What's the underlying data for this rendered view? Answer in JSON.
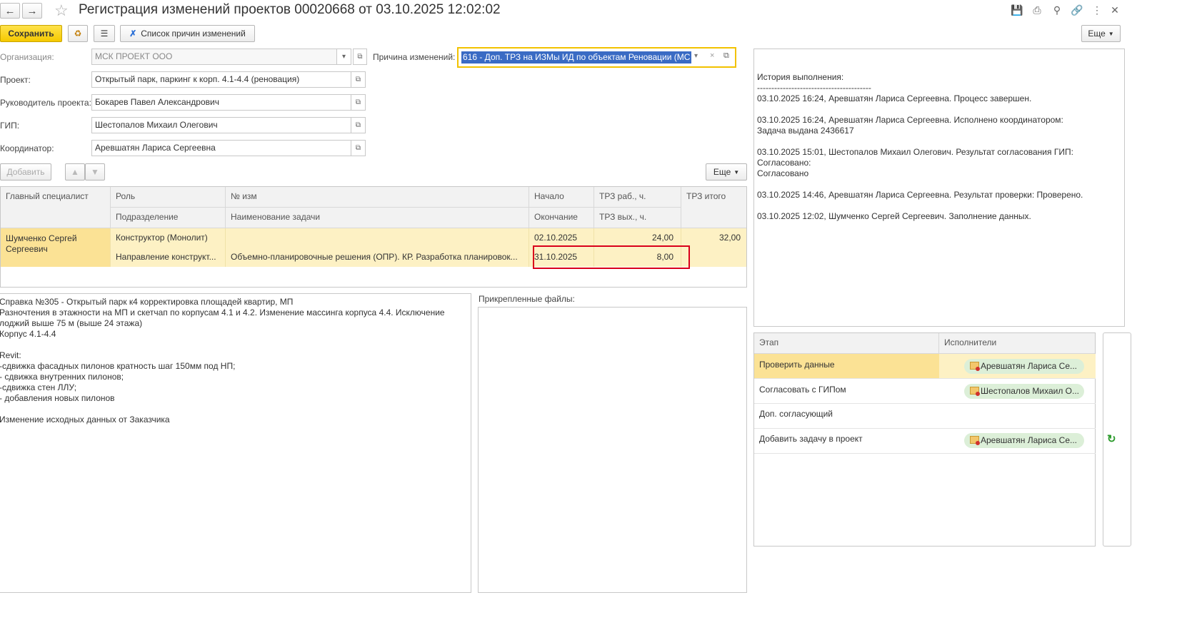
{
  "window": {
    "title": "Регистрация изменений проектов 00020668 от 03.10.2025 12:02:02"
  },
  "toolbar": {
    "save_label": "Сохранить",
    "reasons_list_label": "Список причин изменений",
    "more_label": "Еще"
  },
  "form": {
    "organization": {
      "label": "Организация:",
      "value": "МСК ПРОЕКТ ООО"
    },
    "project": {
      "label": "Проект:",
      "value": "Открытый парк, паркинг к корп. 4.1-4.4 (реновация)"
    },
    "project_manager": {
      "label": "Руководитель проекта:",
      "value": "Бокарев Павел Александрович"
    },
    "gip": {
      "label": "ГИП:",
      "value": "Шестопалов Михаил Олегович"
    },
    "coordinator": {
      "label": "Координатор:",
      "value": "Аревшатян Лариса Сергеевна"
    },
    "reason": {
      "label": "Причина изменений:",
      "value": "616 - Доп. ТРЗ на ИЗМы ИД по объектам Реновации (МС"
    }
  },
  "table_toolbar": {
    "add_label": "Добавить",
    "more_label": "Еще"
  },
  "table": {
    "headers": {
      "main_specialist": "Главный специалист",
      "role": "Роль",
      "department": "Подразделение",
      "change_no": "№ изм",
      "task_name": "Наименование задачи",
      "start": "Начало",
      "end": "Окончание",
      "trz_work": "ТРЗ раб., ч.",
      "trz_weekend": "ТРЗ вых., ч.",
      "trz_total": "ТРЗ итого"
    },
    "rows": [
      {
        "main_specialist": "Шумченко Сергей Сергеевич",
        "role": "Конструктор (Монолит)",
        "department": "Направление конструкт...",
        "change_no": "",
        "task_name": "Объемно-планировочные решения (ОПР). КР. Разработка планировок...",
        "start": "02.10.2025",
        "end": "31.10.2025",
        "trz_work": "24,00",
        "trz_weekend": "8,00",
        "trz_total": "32,00"
      }
    ]
  },
  "description": "Справка №305 - Открытый парк к4 корректировка площадей квартир, МП\nРазночтения в этажности на МП и скетчап по корпусам 4.1 и 4.2. Изменение массинга корпуса 4.4. Исключение лоджий выше 75 м (выше 24 этажа)\nКорпус 4.1-4.4\n\nRevit:\n-сдвижка фасадных пилонов  кратность шаг 150мм под НП;\n- сдвижка внутренних пилонов;\n-сдвижка стен ЛЛУ;\n- добавления новых пилонов\n\nИзменение исходных данных от Заказчика",
  "attachments": {
    "label": "Прикрепленные файлы:"
  },
  "history": {
    "text": "История выполнения:\n----------------------------------------\n03.10.2025 16:24, Аревшатян Лариса Сергеевна. Процесс завершен.\n\n03.10.2025 16:24, Аревшатян Лариса Сергеевна. Исполнено координатором:\nЗадача выдана 2436617\n\n03.10.2025 15:01, Шестопалов Михаил Олегович. Результат согласования ГИП:\nСогласовано:\nСогласовано\n\n03.10.2025 14:46, Аревшатян Лариса Сергеевна. Результат проверки: Проверено.\n\n03.10.2025 12:02, Шумченко Сергей Сергеевич. Заполнение данных."
  },
  "stages": {
    "headers": {
      "stage": "Этап",
      "executors": "Исполнители"
    },
    "rows": [
      {
        "stage": "Проверить данные",
        "executor": "Аревшатян Лариса Се..."
      },
      {
        "stage": "Согласовать с ГИПом",
        "executor": "Шестопалов Михаил О..."
      },
      {
        "stage": "Доп. согласующий",
        "executor": ""
      },
      {
        "stage": "Добавить задачу в проект",
        "executor": "Аревшатян Лариса Се..."
      }
    ]
  },
  "colors": {
    "primary_button": "#f5c900",
    "selection": "#3a6bc4",
    "row_highlight": "#fdf1c4",
    "highlight_box": "#d9001b",
    "executor_badge": "#dcefd8"
  }
}
